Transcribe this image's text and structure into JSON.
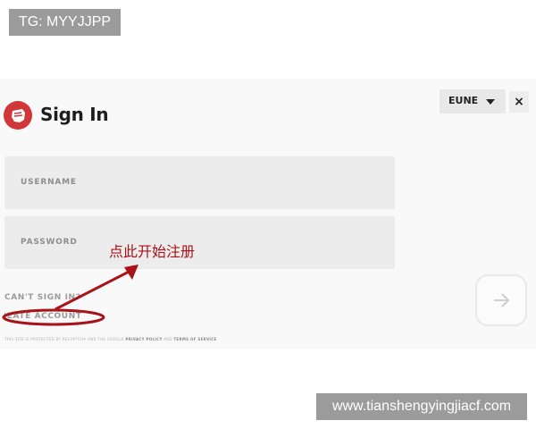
{
  "watermarks": {
    "top": "TG: MYYJJPP",
    "bottom": "www.tianshengyingjiacf.com"
  },
  "header": {
    "title": "Sign In",
    "region": "EUNE",
    "close": "×",
    "logo_icon": "riot-fist-icon"
  },
  "form": {
    "username_placeholder": "USERNAME",
    "password_placeholder": "PASSWORD"
  },
  "links": {
    "cant_sign_in": "CAN'T SIGN IN?",
    "create_account": "CREATE ACCOUNT"
  },
  "footer": {
    "recaptcha_prefix": "THIS SITE IS PROTECTED BY RECAPTCHA AND THE GOOGLE",
    "privacy_policy": "PRIVACY POLICY",
    "and": "AND",
    "terms": "TERMS OF SERVICE"
  },
  "annotation": {
    "text": "点此开始注册",
    "color": "#a8131a"
  },
  "submit": {
    "icon": "arrow-right-icon"
  },
  "colors": {
    "accent": "#d13639",
    "panel": "#f9f9f9",
    "field": "#ececec"
  }
}
